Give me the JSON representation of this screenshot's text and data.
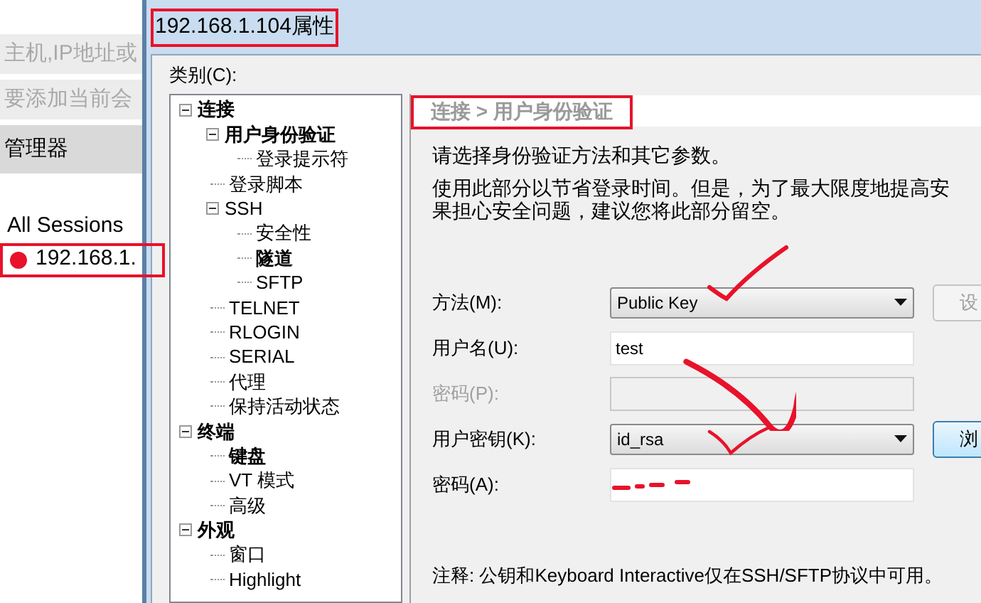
{
  "background_app": {
    "rows": [
      {
        "text": "主机,IP地址或",
        "kind": "hint"
      },
      {
        "text": "要添加当前会",
        "kind": "hint"
      },
      {
        "text": "管理器",
        "kind": "header"
      }
    ],
    "sessions": {
      "root": "All Sessions",
      "items": [
        {
          "label": "192.168.1.",
          "selected": true
        }
      ]
    }
  },
  "dialog": {
    "title": "192.168.1.104属性",
    "category_label": "类别(C):",
    "tree": [
      {
        "label": "连接",
        "bold": true,
        "expanded": true,
        "children": [
          {
            "label": "用户身份验证",
            "bold": true,
            "expanded": true,
            "children": [
              {
                "label": "登录提示符",
                "bold": false
              }
            ]
          },
          {
            "label": "登录脚本",
            "bold": false
          },
          {
            "label": "SSH",
            "bold": false,
            "expanded": true,
            "children": [
              {
                "label": "安全性",
                "bold": false
              },
              {
                "label": "隧道",
                "bold": true
              },
              {
                "label": "SFTP",
                "bold": false
              }
            ]
          },
          {
            "label": "TELNET",
            "bold": false
          },
          {
            "label": "RLOGIN",
            "bold": false
          },
          {
            "label": "SERIAL",
            "bold": false
          },
          {
            "label": "代理",
            "bold": false
          },
          {
            "label": "保持活动状态",
            "bold": false
          }
        ]
      },
      {
        "label": "终端",
        "bold": true,
        "expanded": true,
        "children": [
          {
            "label": "键盘",
            "bold": true
          },
          {
            "label": "VT 模式",
            "bold": false
          },
          {
            "label": "高级",
            "bold": false
          }
        ]
      },
      {
        "label": "外观",
        "bold": true,
        "expanded": true,
        "children": [
          {
            "label": "窗口",
            "bold": false
          },
          {
            "label": "Highlight",
            "bold": false
          }
        ]
      }
    ],
    "breadcrumb": "连接 > 用户身份验证",
    "intro": "请选择身份验证方法和其它参数。",
    "description": [
      "使用此部分以节省登录时间。但是，为了最大限度地提高安",
      "果担心安全问题，建议您将此部分留空。"
    ],
    "fields": [
      {
        "label": "方法(M):",
        "kind": "dropdown",
        "value": "Public Key",
        "disabled": false,
        "button": "设",
        "button_disabled": true
      },
      {
        "label": "用户名(U):",
        "kind": "text",
        "value": "test",
        "disabled": false
      },
      {
        "label": "密码(P):",
        "kind": "text",
        "disabled": true
      },
      {
        "label": "用户密钥(K):",
        "kind": "dropdown",
        "value": "id_rsa",
        "disabled": false,
        "button": "浏",
        "button_disabled": false
      },
      {
        "label": "密码(A):",
        "kind": "text",
        "disabled": false
      }
    ],
    "note": "注释: 公钥和Keyboard Interactive仅在SSH/SFTP协议中可用。"
  }
}
